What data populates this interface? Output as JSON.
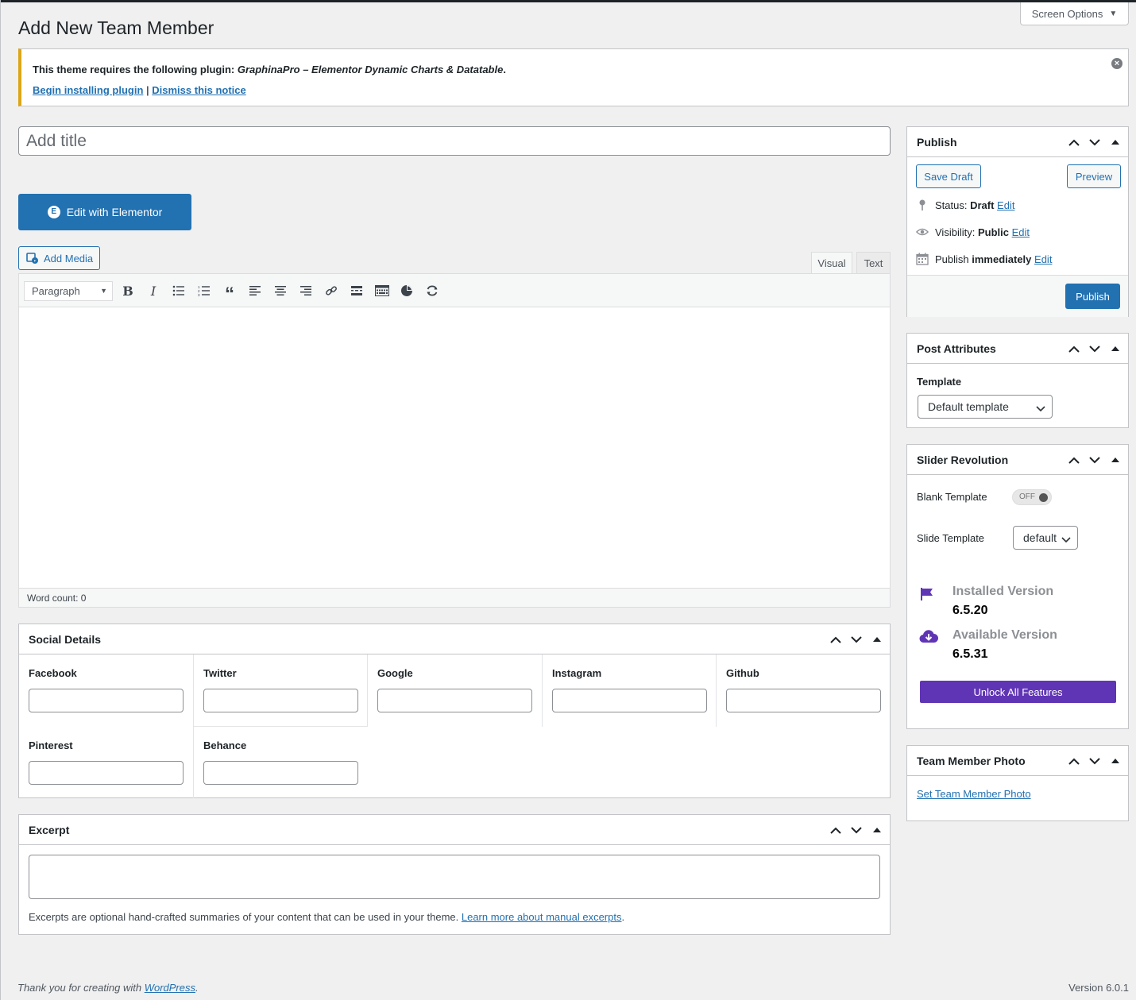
{
  "header": {
    "screen_options": "Screen Options",
    "page_title": "Add New Team Member"
  },
  "notice": {
    "prefix": "This theme requires the following plugin: ",
    "plugin_name": "GraphinaPro – Elementor Dynamic Charts & Datatable",
    "suffix": ".",
    "begin_link": "Begin installing plugin",
    "separator": " | ",
    "dismiss_link": "Dismiss this notice",
    "accent_color": "#dba617"
  },
  "title_field": {
    "placeholder": "Add title",
    "value": ""
  },
  "elementor": {
    "button_label": "Edit with Elementor",
    "logo_glyph": "E"
  },
  "editor": {
    "add_media_label": "Add Media",
    "tabs": [
      {
        "label": "Visual",
        "active": true
      },
      {
        "label": "Text",
        "active": false
      }
    ],
    "format_select": "Paragraph",
    "toolbar_icons": [
      "bold-icon",
      "italic-icon",
      "bulleted-list-icon",
      "numbered-list-icon",
      "blockquote-icon",
      "align-left-icon",
      "align-center-icon",
      "align-right-icon",
      "link-icon",
      "read-more-icon",
      "toolbar-toggle-icon",
      "chart-icon",
      "refresh-icon"
    ],
    "word_count": "Word count: 0"
  },
  "social_details": {
    "title": "Social Details",
    "fields": [
      {
        "label": "Facebook",
        "value": ""
      },
      {
        "label": "Twitter",
        "value": ""
      },
      {
        "label": "Google",
        "value": ""
      },
      {
        "label": "Instagram",
        "value": ""
      },
      {
        "label": "Github",
        "value": ""
      },
      {
        "label": "Pinterest",
        "value": ""
      },
      {
        "label": "Behance",
        "value": ""
      }
    ]
  },
  "excerpt": {
    "title": "Excerpt",
    "value": "",
    "help_text": "Excerpts are optional hand-crafted summaries of your content that can be used in your theme. ",
    "help_link": "Learn more about manual excerpts",
    "help_suffix": "."
  },
  "publish": {
    "title": "Publish",
    "save_draft": "Save Draft",
    "preview": "Preview",
    "status_label": "Status: ",
    "status_value": "Draft",
    "visibility_label": "Visibility: ",
    "visibility_value": "Public",
    "schedule_label": "Publish ",
    "schedule_value": "immediately",
    "edit_link": "Edit",
    "publish_button": "Publish",
    "primary_color": "#2271b1"
  },
  "post_attributes": {
    "title": "Post Attributes",
    "template_label": "Template",
    "template_value": "Default template"
  },
  "slider_revolution": {
    "title": "Slider Revolution",
    "blank_template_label": "Blank Template",
    "toggle_state": "OFF",
    "slide_template_label": "Slide Template",
    "slide_template_value": "default",
    "installed_label": "Installed Version",
    "installed_version": "6.5.20",
    "available_label": "Available Version",
    "available_version": "6.5.31",
    "unlock_button": "Unlock All Features",
    "accent_color": "#6035b5"
  },
  "team_member_photo": {
    "title": "Team Member Photo",
    "set_link": "Set Team Member Photo"
  },
  "footer": {
    "thanks_prefix": "Thank you for creating with ",
    "thanks_link": "WordPress",
    "thanks_suffix": ".",
    "version": "Version 6.0.1"
  }
}
